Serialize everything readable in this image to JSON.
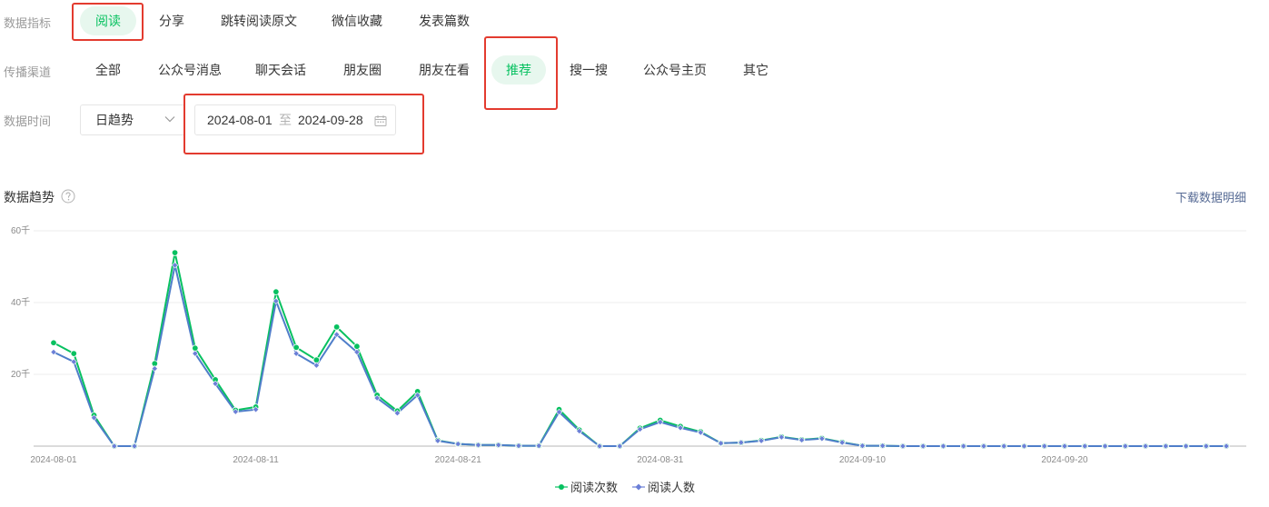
{
  "metric_row": {
    "label": "数据指标",
    "options": [
      "阅读",
      "分享",
      "跳转阅读原文",
      "微信收藏",
      "发表篇数"
    ],
    "selected_index": 0
  },
  "channel_row": {
    "label": "传播渠道",
    "options": [
      "全部",
      "公众号消息",
      "聊天会话",
      "朋友圈",
      "朋友在看",
      "推荐",
      "搜一搜",
      "公众号主页",
      "其它"
    ],
    "selected_index": 5
  },
  "time_row": {
    "label": "数据时间",
    "granularity": "日趋势",
    "start_date": "2024-08-01",
    "separator": "至",
    "end_date": "2024-09-28"
  },
  "trend_section": {
    "title": "数据趋势",
    "download_label": "下载数据明细"
  },
  "colors": {
    "accent_green": "#07c160",
    "selected_bg": "#e7f7ee",
    "highlight_red": "#e33b2f",
    "series_reads": "#07c160",
    "series_users": "#6b7fd7",
    "line_users": "#4f7ec9"
  },
  "icons": {
    "help": "question-circle-icon",
    "dropdown": "chevron-down-icon",
    "calendar": "calendar-icon"
  },
  "chart_data": {
    "type": "line",
    "ylim": [
      0,
      60
    ],
    "y_ticks": [
      {
        "value": 20,
        "label": "20千"
      },
      {
        "value": 40,
        "label": "40千"
      },
      {
        "value": 60,
        "label": "60千"
      }
    ],
    "x_tick_labels": [
      {
        "index": 0,
        "label": "2024-08-01"
      },
      {
        "index": 10,
        "label": "2024-08-11"
      },
      {
        "index": 20,
        "label": "2024-08-21"
      },
      {
        "index": 30,
        "label": "2024-08-31"
      },
      {
        "index": 40,
        "label": "2024-09-10"
      },
      {
        "index": 50,
        "label": "2024-09-20"
      }
    ],
    "x_start": "2024-08-01",
    "series": [
      {
        "name": "阅读次数",
        "values": [
          28.8,
          25.8,
          8.6,
          0,
          0,
          23.0,
          53.9,
          27.3,
          18.5,
          10.0,
          10.9,
          43.0,
          27.5,
          24.0,
          33.2,
          27.8,
          14.2,
          9.8,
          15.2,
          1.6,
          0.6,
          0.3,
          0.3,
          0.1,
          0.1,
          10.2,
          4.5,
          0,
          0,
          5.0,
          7.2,
          5.5,
          4.0,
          0.8,
          1.0,
          1.6,
          2.6,
          1.8,
          2.2,
          1.1,
          0.1,
          0.1,
          0,
          0,
          0,
          0,
          0,
          0,
          0,
          0,
          0,
          0,
          0,
          0,
          0,
          0,
          0,
          0,
          0
        ]
      },
      {
        "name": "阅读人数",
        "values": [
          26.2,
          23.5,
          7.9,
          0,
          0,
          21.6,
          50.4,
          25.8,
          17.4,
          9.6,
          10.2,
          40.4,
          25.8,
          22.5,
          31.1,
          26.2,
          13.4,
          9.2,
          14.2,
          1.5,
          0.6,
          0.3,
          0.3,
          0.1,
          0.1,
          9.5,
          4.2,
          0,
          0,
          4.7,
          6.7,
          5.1,
          3.8,
          0.8,
          1.0,
          1.5,
          2.5,
          1.7,
          2.1,
          1.0,
          0.1,
          0.1,
          0,
          0,
          0,
          0,
          0,
          0,
          0,
          0,
          0,
          0,
          0,
          0,
          0,
          0,
          0,
          0,
          0
        ]
      }
    ],
    "legend": [
      "阅读次数",
      "阅读人数"
    ],
    "legend_position": "bottom-center",
    "grid": true
  }
}
